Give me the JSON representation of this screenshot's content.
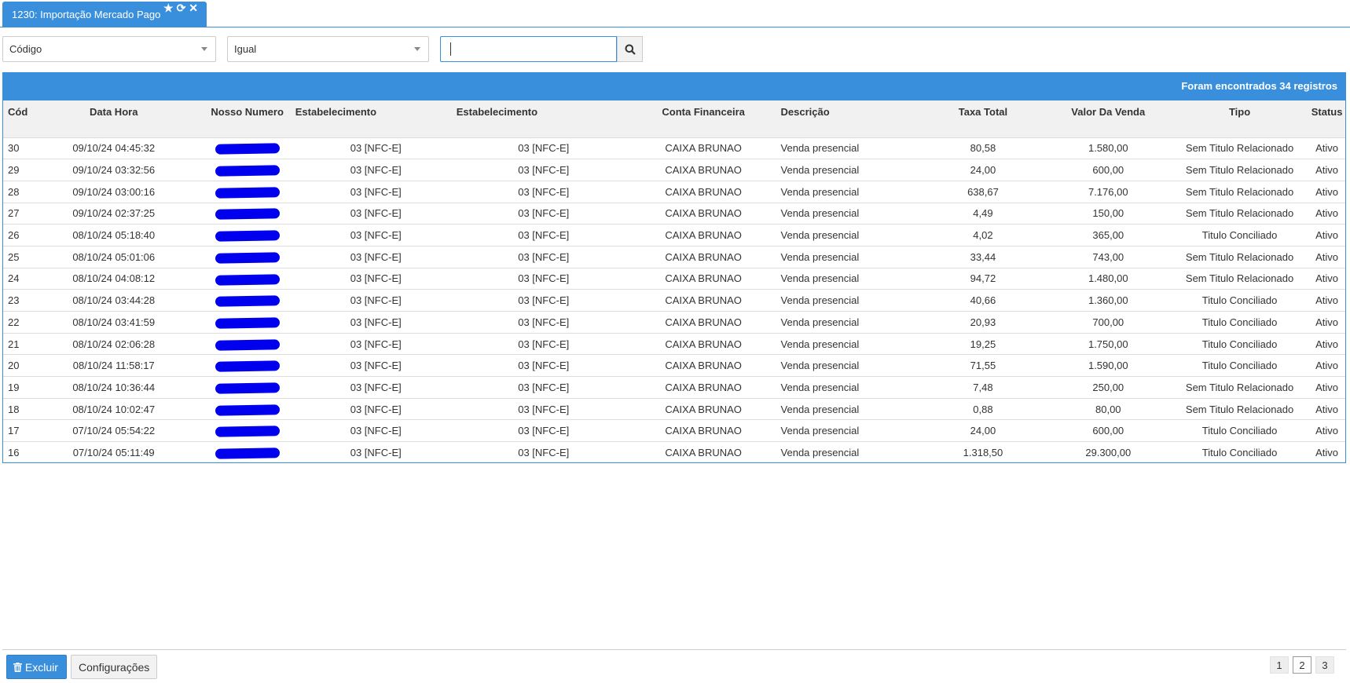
{
  "tab": {
    "title": "1230: Importação Mercado Pago"
  },
  "filters": {
    "field": "Código",
    "operator": "Igual",
    "search_value": ""
  },
  "grid": {
    "summary": "Foram encontrados 34 registros",
    "columns": [
      "Cód",
      "Data Hora",
      "Nosso Numero",
      "Estabelecimento",
      "Estabelecimento",
      "Conta Financeira",
      "Descrição",
      "Taxa Total",
      "Valor Da Venda",
      "Tipo",
      "Status"
    ],
    "rows": [
      [
        "30",
        "09/10/24 04:45:32",
        "",
        "03 [NFC-E]",
        "03 [NFC-E]",
        "CAIXA BRUNAO",
        "Venda presencial",
        "80,58",
        "1.580,00",
        "Sem Titulo Relacionado",
        "Ativo"
      ],
      [
        "29",
        "09/10/24 03:32:56",
        "",
        "03 [NFC-E]",
        "03 [NFC-E]",
        "CAIXA BRUNAO",
        "Venda presencial",
        "24,00",
        "600,00",
        "Sem Titulo Relacionado",
        "Ativo"
      ],
      [
        "28",
        "09/10/24 03:00:16",
        "",
        "03 [NFC-E]",
        "03 [NFC-E]",
        "CAIXA BRUNAO",
        "Venda presencial",
        "638,67",
        "7.176,00",
        "Sem Titulo Relacionado",
        "Ativo"
      ],
      [
        "27",
        "09/10/24 02:37:25",
        "",
        "03 [NFC-E]",
        "03 [NFC-E]",
        "CAIXA BRUNAO",
        "Venda presencial",
        "4,49",
        "150,00",
        "Sem Titulo Relacionado",
        "Ativo"
      ],
      [
        "26",
        "08/10/24 05:18:40",
        "",
        "03 [NFC-E]",
        "03 [NFC-E]",
        "CAIXA BRUNAO",
        "Venda presencial",
        "4,02",
        "365,00",
        "Titulo Conciliado",
        "Ativo"
      ],
      [
        "25",
        "08/10/24 05:01:06",
        "",
        "03 [NFC-E]",
        "03 [NFC-E]",
        "CAIXA BRUNAO",
        "Venda presencial",
        "33,44",
        "743,00",
        "Sem Titulo Relacionado",
        "Ativo"
      ],
      [
        "24",
        "08/10/24 04:08:12",
        "",
        "03 [NFC-E]",
        "03 [NFC-E]",
        "CAIXA BRUNAO",
        "Venda presencial",
        "94,72",
        "1.480,00",
        "Sem Titulo Relacionado",
        "Ativo"
      ],
      [
        "23",
        "08/10/24 03:44:28",
        "",
        "03 [NFC-E]",
        "03 [NFC-E]",
        "CAIXA BRUNAO",
        "Venda presencial",
        "40,66",
        "1.360,00",
        "Titulo Conciliado",
        "Ativo"
      ],
      [
        "22",
        "08/10/24 03:41:59",
        "",
        "03 [NFC-E]",
        "03 [NFC-E]",
        "CAIXA BRUNAO",
        "Venda presencial",
        "20,93",
        "700,00",
        "Titulo Conciliado",
        "Ativo"
      ],
      [
        "21",
        "08/10/24 02:06:28",
        "",
        "03 [NFC-E]",
        "03 [NFC-E]",
        "CAIXA BRUNAO",
        "Venda presencial",
        "19,25",
        "1.750,00",
        "Titulo Conciliado",
        "Ativo"
      ],
      [
        "20",
        "08/10/24 11:58:17",
        "",
        "03 [NFC-E]",
        "03 [NFC-E]",
        "CAIXA BRUNAO",
        "Venda presencial",
        "71,55",
        "1.590,00",
        "Titulo Conciliado",
        "Ativo"
      ],
      [
        "19",
        "08/10/24 10:36:44",
        "",
        "03 [NFC-E]",
        "03 [NFC-E]",
        "CAIXA BRUNAO",
        "Venda presencial",
        "7,48",
        "250,00",
        "Sem Titulo Relacionado",
        "Ativo"
      ],
      [
        "18",
        "08/10/24 10:02:47",
        "",
        "03 [NFC-E]",
        "03 [NFC-E]",
        "CAIXA BRUNAO",
        "Venda presencial",
        "0,88",
        "80,00",
        "Sem Titulo Relacionado",
        "Ativo"
      ],
      [
        "17",
        "07/10/24 05:54:22",
        "",
        "03 [NFC-E]",
        "03 [NFC-E]",
        "CAIXA BRUNAO",
        "Venda presencial",
        "24,00",
        "600,00",
        "Titulo Conciliado",
        "Ativo"
      ],
      [
        "16",
        "07/10/24 05:11:49",
        "",
        "03 [NFC-E]",
        "03 [NFC-E]",
        "CAIXA BRUNAO",
        "Venda presencial",
        "1.318,50",
        "29.300,00",
        "Titulo Conciliado",
        "Ativo"
      ]
    ]
  },
  "footer": {
    "delete_label": "Excluir",
    "settings_label": "Configurações"
  },
  "pagination": {
    "pages": [
      "1",
      "2",
      "3"
    ],
    "current": "2"
  },
  "colors": {
    "accent": "#3a8fdc",
    "redaction": "#0000ee"
  },
  "icons": [
    "star-icon",
    "refresh-icon",
    "close-icon",
    "search-icon",
    "trash-icon",
    "chevron-down-icon"
  ]
}
